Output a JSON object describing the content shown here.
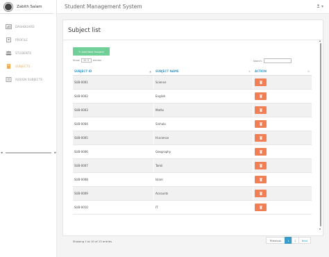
{
  "user": {
    "name": "Zabith Salam"
  },
  "sidebar": {
    "items": [
      {
        "label": "DASHBOARD",
        "icon": "dashboard-icon",
        "active": false
      },
      {
        "label": "PROFILE",
        "icon": "profile-icon",
        "active": false
      },
      {
        "label": "STUDENTS",
        "icon": "students-icon",
        "active": false
      },
      {
        "label": "SUBJECTS",
        "icon": "book-icon",
        "active": true
      },
      {
        "label": "ASSIGN SUBJECTS",
        "icon": "assign-icon",
        "active": false
      }
    ]
  },
  "header": {
    "title": "Student Management System",
    "user_icon": "user-icon",
    "caret": "▾"
  },
  "card": {
    "title": "Subject list",
    "add_label": "✎ Add New Subject"
  },
  "controls": {
    "show_label": "Show",
    "entries_value": "10",
    "entries_label": "entries",
    "search_label": "Search:"
  },
  "table": {
    "headers": [
      "SUBJECT ID",
      "SUBJECT NAME",
      "ACTION"
    ],
    "rows": [
      [
        "SUB-0001",
        "Science"
      ],
      [
        "SUB-0002",
        "English"
      ],
      [
        "SUB-0003",
        "Maths"
      ],
      [
        "SUB-0004",
        "Sinhala"
      ],
      [
        "SUB-0005",
        "H.science"
      ],
      [
        "SUB-0006",
        "Geography"
      ],
      [
        "SUB-0007",
        "Tamil"
      ],
      [
        "SUB-0008",
        "Islam"
      ],
      [
        "SUB-0009",
        "Accounts"
      ],
      [
        "SUB-0010",
        "IT"
      ]
    ]
  },
  "footer": {
    "info": "Showing 1 to 10 of 13 entries",
    "prev": "Previous",
    "pages": [
      "1",
      "2"
    ],
    "current_page": "1",
    "next": "Next"
  },
  "colors": {
    "accent": "#3b9cc9",
    "add_button": "#6fcf97",
    "delete_button": "#f07f55",
    "active_nav": "#f0ab55"
  }
}
